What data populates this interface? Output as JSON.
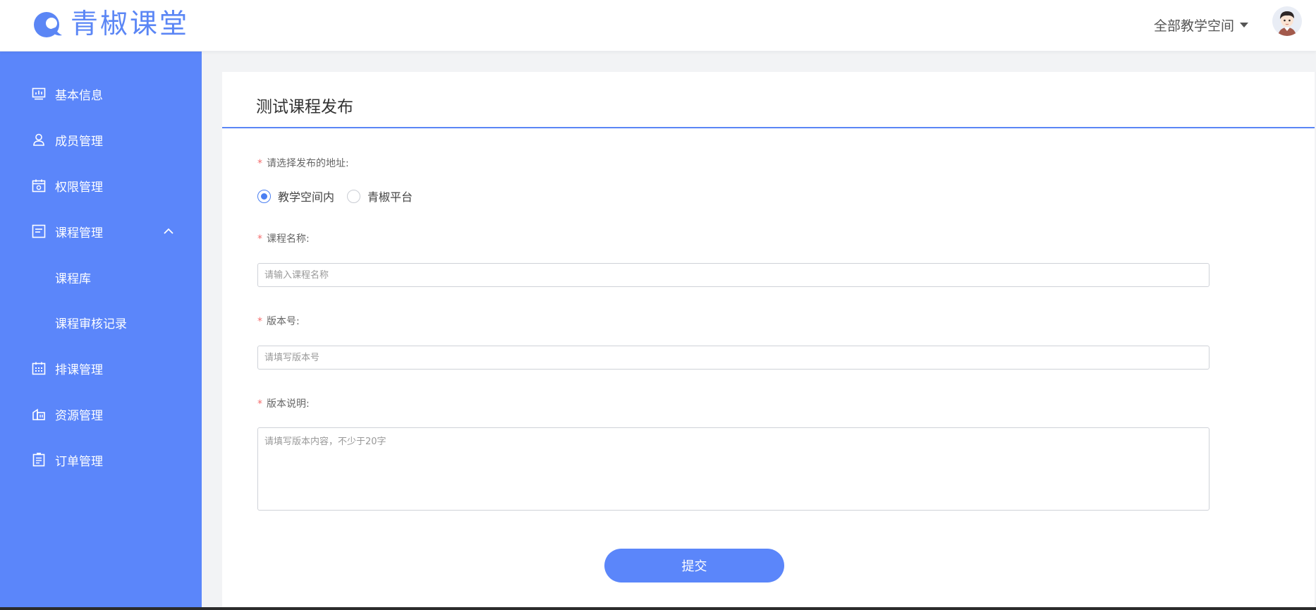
{
  "header": {
    "logo_text": "青椒课堂",
    "space_selector": "全部教学空间",
    "brand_color": "#5b86f5"
  },
  "sidebar": {
    "background": "#5b86fa",
    "items": [
      {
        "label": "基本信息",
        "icon": "dashboard-icon"
      },
      {
        "label": "成员管理",
        "icon": "user-icon"
      },
      {
        "label": "权限管理",
        "icon": "calendar-lock-icon"
      },
      {
        "label": "课程管理",
        "icon": "document-icon",
        "expanded": true,
        "children": [
          {
            "label": "课程库"
          },
          {
            "label": "课程审核记录"
          }
        ]
      },
      {
        "label": "排课管理",
        "icon": "schedule-icon"
      },
      {
        "label": "资源管理",
        "icon": "resource-icon"
      },
      {
        "label": "订单管理",
        "icon": "order-icon"
      }
    ]
  },
  "form": {
    "title": "测试课程发布",
    "address": {
      "label": "请选择发布的地址:",
      "options": [
        "教学空间内",
        "青椒平台"
      ],
      "selected": "教学空间内"
    },
    "course_name": {
      "label": "课程名称:",
      "value": "",
      "placeholder": "请输入课程名称"
    },
    "version": {
      "label": "版本号:",
      "value": "",
      "placeholder": "请填写版本号"
    },
    "version_notes": {
      "label": "版本说明:",
      "value": "",
      "placeholder": "请填写版本内容，不少于20字"
    },
    "required_mark": "*",
    "submit_label": "提交"
  }
}
